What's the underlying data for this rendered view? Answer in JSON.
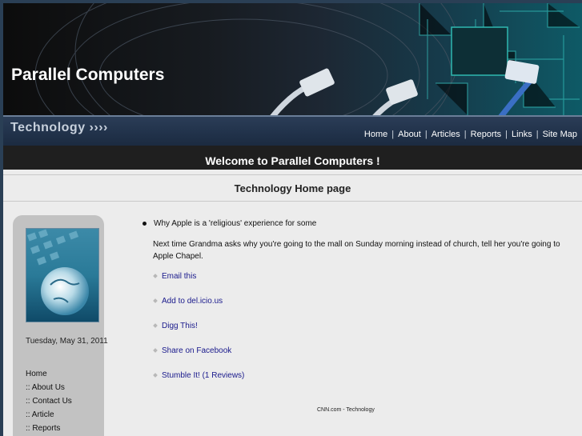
{
  "header": {
    "site_title": "Parallel Computers",
    "section_label": "Technology ››››",
    "nav": [
      {
        "label": "Home"
      },
      {
        "label": "About"
      },
      {
        "label": "Articles"
      },
      {
        "label": "Reports"
      },
      {
        "label": "Links"
      },
      {
        "label": "Site Map"
      }
    ]
  },
  "welcome": "Welcome to Parallel Computers !",
  "subheading": "Technology Home page",
  "sidebar": {
    "date": "Tuesday, May 31, 2011",
    "nav": [
      {
        "label": "Home"
      },
      {
        "label": ":: About Us"
      },
      {
        "label": ":: Contact Us"
      },
      {
        "label": ":: Article"
      },
      {
        "label": ":: Reports"
      }
    ]
  },
  "article": {
    "headline": "Why Apple is a 'religious' experience for some",
    "summary": "Next time Grandma asks why you're going to the mall on Sunday morning instead of church, tell her you're going to Apple Chapel.",
    "share_links": [
      {
        "label": "Email this"
      },
      {
        "label": "Add to del.icio.us"
      },
      {
        "label": "Digg This!"
      },
      {
        "label": "Share on Facebook"
      },
      {
        "label": "Stumble It! (1 Reviews)"
      }
    ],
    "source": "CNN.com - Technology"
  }
}
